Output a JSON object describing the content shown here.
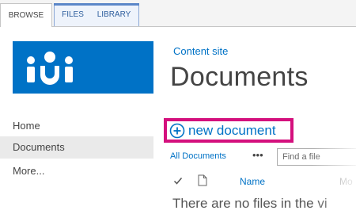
{
  "ribbon": {
    "tabs": [
      {
        "label": "BROWSE"
      },
      {
        "label": "FILES"
      },
      {
        "label": "LIBRARY"
      }
    ]
  },
  "site": {
    "logo_icon": "people-group-icon",
    "logo_color": "#0072c6",
    "breadcrumb_link": "Content site",
    "page_title": "Documents"
  },
  "nav": {
    "items": [
      {
        "label": "Home"
      },
      {
        "label": "Documents"
      },
      {
        "label": "More..."
      }
    ]
  },
  "toolbar": {
    "new_document_label": "new document",
    "highlight_color": "#d4107d"
  },
  "view": {
    "current_view": "All Documents",
    "more_label": "•••",
    "search_placeholder": "Find a file"
  },
  "list": {
    "columns": {
      "name": "Name",
      "modified": "Mo"
    },
    "empty_message": "There are no files in the vi"
  }
}
